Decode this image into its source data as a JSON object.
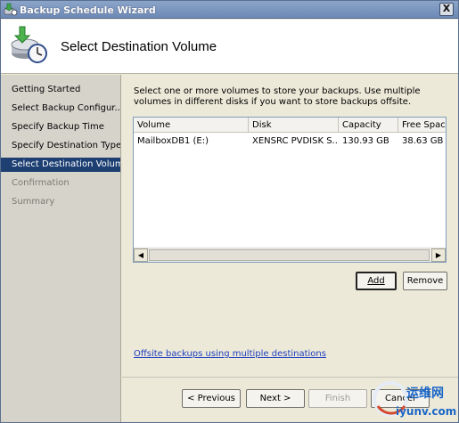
{
  "window": {
    "title": "Backup Schedule Wizard",
    "close_glyph": "X"
  },
  "header": {
    "title": "Select Destination Volume",
    "icon": "backup-clock-icon"
  },
  "nav": {
    "items": [
      {
        "label": "Getting Started",
        "state": "normal"
      },
      {
        "label": "Select Backup Configur...",
        "state": "normal"
      },
      {
        "label": "Specify Backup Time",
        "state": "normal"
      },
      {
        "label": "Specify Destination Type",
        "state": "normal"
      },
      {
        "label": "Select Destination Volume",
        "state": "active"
      },
      {
        "label": "Confirmation",
        "state": "disabled"
      },
      {
        "label": "Summary",
        "state": "disabled"
      }
    ]
  },
  "content": {
    "instructions": "Select one or more volumes to store your backups. Use multiple volumes in different disks if you want to store backups offsite.",
    "table": {
      "columns": [
        "Volume",
        "Disk",
        "Capacity",
        "Free Space"
      ],
      "rows": [
        [
          "MailboxDB1 (E:)",
          "XENSRC PVDISK S...",
          "130.93 GB",
          "38.63 GB"
        ]
      ]
    },
    "add_button": "Add",
    "remove_button": "Remove",
    "link": "Offsite backups using multiple destinations"
  },
  "footer": {
    "previous": "< Previous",
    "next": "Next >",
    "finish": "Finish",
    "cancel": "Cancel"
  },
  "watermark": {
    "top": "运维网",
    "bottom": "iyunv.com"
  },
  "colors": {
    "active_nav_bg": "#1d3f72",
    "link": "#1f3fbf",
    "title_bar": "#7a95bf"
  }
}
